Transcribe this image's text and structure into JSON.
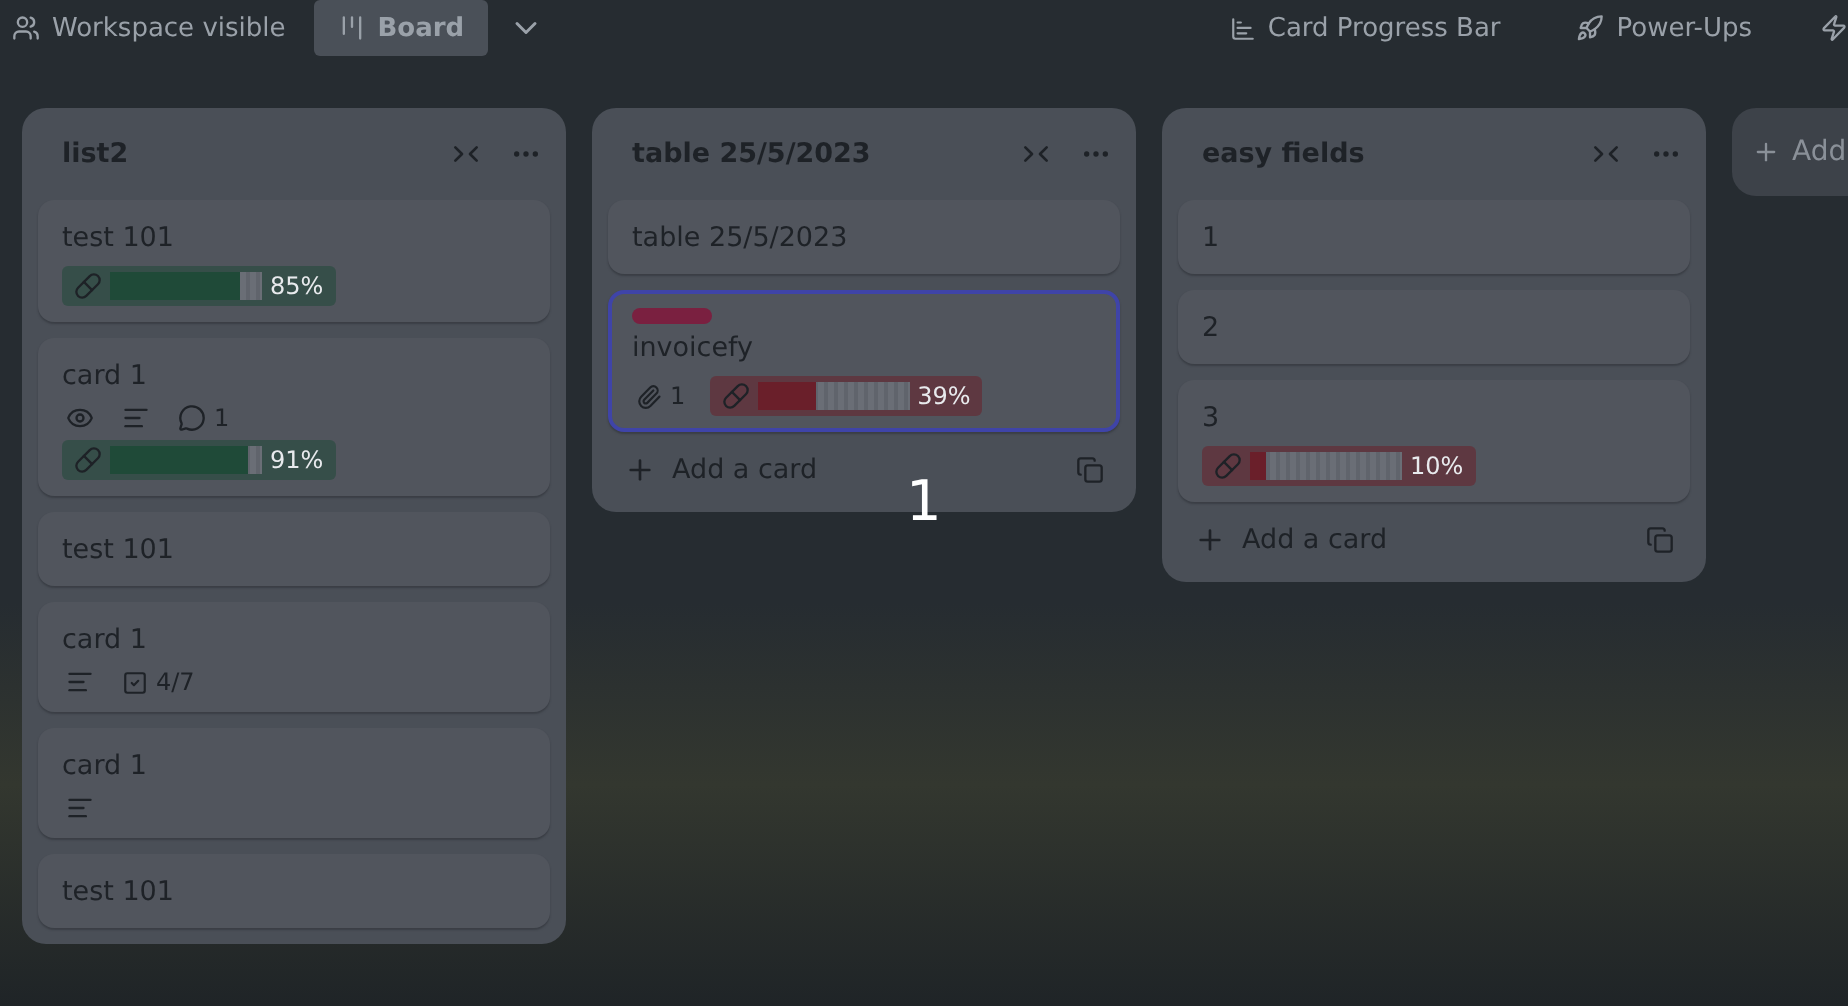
{
  "top_bar": {
    "workspace": "Workspace visible",
    "views": [
      {
        "label": "Board",
        "selected": true
      }
    ],
    "power_up_button": "Card Progress Bar",
    "power_ups": "Power-Ups"
  },
  "lists": [
    {
      "title": "list2",
      "cards": [
        {
          "title": "test 101",
          "selected": false,
          "progress": {
            "level": 0.85,
            "reading": "85%",
            "color": "#1f4a38"
          }
        },
        {
          "title": "card 1",
          "selected": false,
          "badges": [
            {
              "kind": "watch"
            },
            {
              "kind": "description"
            },
            {
              "kind": "comments",
              "text": "1"
            }
          ],
          "progress": {
            "level": 0.91,
            "reading": "91%",
            "color": "#1f4a38"
          }
        },
        {
          "title": "test 101",
          "selected": false
        },
        {
          "title": "card 1",
          "selected": false,
          "badges": [
            {
              "kind": "description"
            },
            {
              "kind": "checklist",
              "text": "4/7"
            }
          ]
        },
        {
          "title": "card 1",
          "selected": false,
          "badges": [
            {
              "kind": "description"
            }
          ]
        },
        {
          "title": "test 101",
          "selected": false
        }
      ]
    },
    {
      "title": "table 25/5/2023",
      "add_card": "Add a card",
      "cards": [
        {
          "title": "table 25/5/2023",
          "selected": false
        },
        {
          "title": "invoicefy",
          "selected": true,
          "label": {
            "color": "#7a2040"
          },
          "badges": [
            {
              "kind": "attachments",
              "text": "1"
            }
          ],
          "progress": {
            "level": 0.39,
            "reading": "39%",
            "color": "#6a1f2a"
          }
        }
      ]
    },
    {
      "title": "easy fields",
      "add_card": "Add a card",
      "cards": [
        {
          "title": "1",
          "selected": false
        },
        {
          "title": "2",
          "selected": false
        },
        {
          "title": "3",
          "selected": false,
          "progress": {
            "level": 0.1,
            "reading": "10%",
            "color": "#6a1f2a"
          }
        }
      ]
    }
  ],
  "add_list": "Add",
  "overlay_number": "1"
}
